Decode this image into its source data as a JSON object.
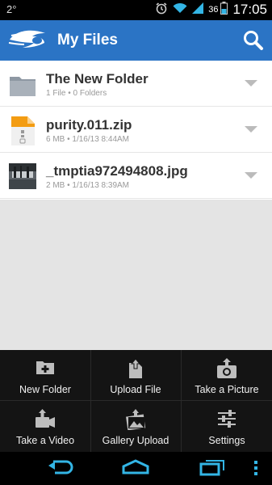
{
  "status_bar": {
    "left_text": "2°",
    "battery_level": "36",
    "time": "17:05",
    "icons": [
      "alarm-icon",
      "wifi-icon",
      "signal-icon",
      "battery-icon"
    ]
  },
  "action_bar": {
    "title": "My Files",
    "logo": "mediafire-logo",
    "search_icon": "search-icon",
    "color": "#2b74c5"
  },
  "files": [
    {
      "name": "The New Folder",
      "meta": "1 File • 0 Folders",
      "type": "folder",
      "icon": "folder-icon"
    },
    {
      "name": "purity.011.zip",
      "meta": "6 MB • 1/16/13 8:44AM",
      "type": "zip",
      "icon": "zip-file-icon"
    },
    {
      "name": "_tmptia972494808.jpg",
      "meta": "2 MB • 1/16/13 8:39AM",
      "type": "image",
      "icon": "image-thumbnail"
    }
  ],
  "actions": [
    {
      "label": "New Folder",
      "icon": "new-folder-icon"
    },
    {
      "label": "Upload File",
      "icon": "upload-file-icon"
    },
    {
      "label": "Take a Picture",
      "icon": "camera-upload-icon"
    },
    {
      "label": "Take a Video",
      "icon": "video-upload-icon"
    },
    {
      "label": "Gallery Upload",
      "icon": "gallery-upload-icon"
    },
    {
      "label": "Settings",
      "icon": "settings-sliders-icon"
    }
  ],
  "nav_bar": {
    "buttons": [
      "back-icon",
      "home-icon",
      "recent-apps-icon",
      "overflow-menu-icon"
    ],
    "accent": "#33b5e5"
  }
}
